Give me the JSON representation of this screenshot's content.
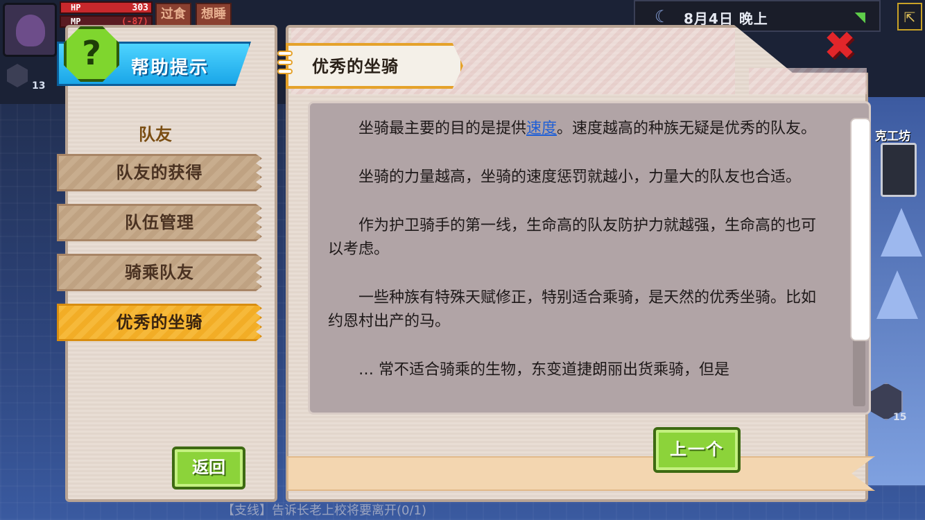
{
  "hud": {
    "hp_label": "HP",
    "hp_value": "303",
    "mp_label": "MP",
    "mp_value": "(-87)",
    "status_effects": [
      "过食",
      "想睡"
    ],
    "level_left": "13",
    "level_right": "15",
    "date": "8月4日",
    "time_of_day": "晚上",
    "workshop_label": "克工坊",
    "quest_text": "【支线】告诉长老上校将要离开(0/1)"
  },
  "help": {
    "header_title": "帮助提示",
    "help_icon_glyph": "?",
    "section_title": "队友",
    "menu_items": [
      {
        "label": "队友的获得",
        "active": false
      },
      {
        "label": "队伍管理",
        "active": false
      },
      {
        "label": "骑乘队友",
        "active": false
      },
      {
        "label": "优秀的坐骑",
        "active": true
      }
    ],
    "back_label": "返回"
  },
  "article": {
    "title": "优秀的坐骑",
    "close_glyph": "✖",
    "p1_before": "坐骑最主要的目的是提供",
    "p1_link": "速度",
    "p1_after": "。速度越高的种族无疑是优秀的队友。",
    "p2": "坐骑的力量越高，坐骑的速度惩罚就越小，力量大的队友也合适。",
    "p3": "作为护卫骑手的第一线，生命高的队友防护力就越强，生命高的也可以考虑。",
    "p4": "一些种族有特殊天赋修正，特别适合乘骑，是天然的优秀坐骑。比如约恩村出产的马。",
    "p5": "… 常不适合骑乘的生物，东变道捷朗丽出货乘骑，但是",
    "prev_label": "上一个"
  },
  "colors": {
    "accent_blue": "#1aa6e8",
    "button_green": "#8cd33a",
    "active_orange": "#f2ad26",
    "link_blue": "#1f5fd6",
    "close_red": "#e2262a"
  }
}
